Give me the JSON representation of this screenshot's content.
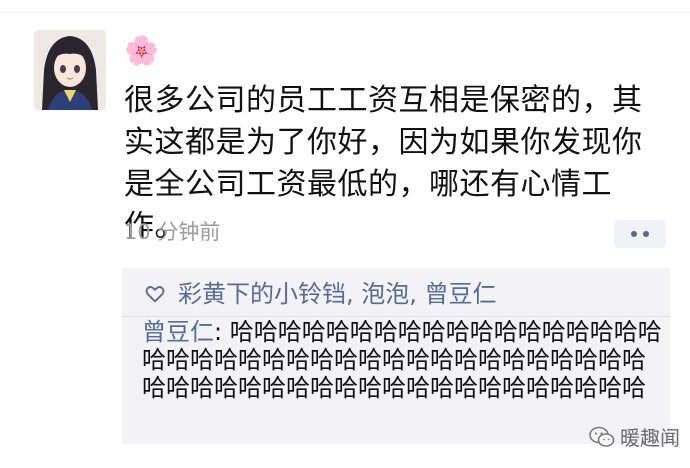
{
  "post": {
    "username_emoji": "🌸",
    "text": "很多公司的员工工资互相是保密的，其实这都是为了你好，因为如果你发现你是全公司工资最低的，哪还有心情工作。",
    "timestamp": "10 分钟前"
  },
  "likes": {
    "names": "彩黄下的小铃铛, 泡泡, 曾豆仁"
  },
  "comment": {
    "author": "曾豆仁",
    "separator": ": ",
    "text": "哈哈哈哈哈哈哈哈哈哈哈哈哈哈哈哈哈哈哈哈哈哈哈哈哈哈哈哈哈哈哈哈哈哈哈哈哈哈哈哈哈哈哈哈哈哈哈哈哈哈哈哈哈哈哈哈哈哈哈哈"
  },
  "watermark": {
    "text": "暖趣闻"
  },
  "colors": {
    "link": "#566b96",
    "timestamp": "#9c9c9c",
    "comment_bg": "#f3f3f5"
  }
}
